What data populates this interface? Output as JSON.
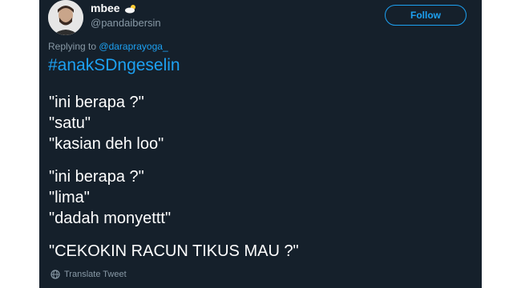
{
  "tweet": {
    "display_name": "mbee",
    "handle": "@pandaibersin",
    "follow_label": "Follow",
    "replying_prefix": "Replying to",
    "replying_to": "@daraprayoga_",
    "hashtag": "#anakSDngeselin",
    "lines": [
      "\"ini berapa ?\"",
      "\"satu\"",
      "\"kasian deh loo\"",
      "\"ini berapa ?\"",
      "\"lima\"",
      "\"dadah monyettt\"",
      "\"CEKOKIN RACUN TIKUS MAU ?\""
    ],
    "translate_label": "Translate Tweet"
  },
  "colors": {
    "background": "#15202b",
    "accent": "#1da1f2",
    "muted": "#8899a6",
    "text": "#ffffff"
  },
  "icons": {
    "avatar": "user-avatar-photo",
    "badge": "cloud-sun-emoji-icon",
    "translate": "globe-icon"
  }
}
